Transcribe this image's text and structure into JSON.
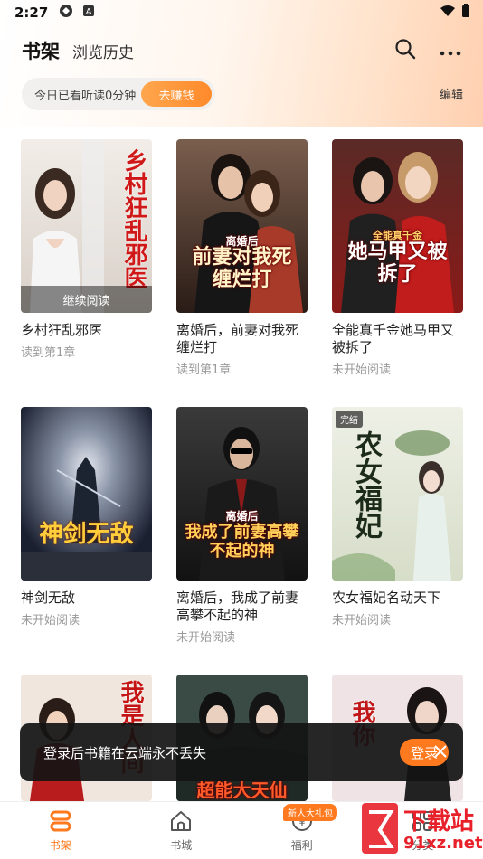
{
  "status_bar": {
    "time": "2:27"
  },
  "header": {
    "tab_shelf": "书架",
    "tab_history": "浏览历史"
  },
  "reading_pill": {
    "text": "今日已看听读0分钟",
    "earn_label": "去赚钱"
  },
  "edit_label": "编辑",
  "books": [
    {
      "title": "乡村狂乱邪医",
      "status": "读到第1章",
      "cover_text": "乡村狂乱邪医",
      "overlay": "继续阅读"
    },
    {
      "title": "离婚后，前妻对我死缠烂打",
      "status": "读到第1章",
      "cover_text": "前妻对我死缠烂打",
      "cover_sub": "离婚后"
    },
    {
      "title": "全能真千金她马甲又被拆了",
      "status": "未开始阅读",
      "cover_text": "她马甲又被拆了",
      "cover_sub": "全能真千金"
    },
    {
      "title": "神剑无敌",
      "status": "未开始阅读",
      "cover_text": "神剑无敌"
    },
    {
      "title": "离婚后，我成了前妻高攀不起的神",
      "status": "未开始阅读",
      "cover_text": "我成了前妻高攀不起的神",
      "cover_sub": "离婚后"
    },
    {
      "title": "农女福妃名动天下",
      "status": "未开始阅读",
      "cover_text": "农女福妃",
      "badge": "完结"
    },
    {
      "title": "",
      "status": "",
      "cover_text": "我是人间"
    },
    {
      "title": "",
      "status": "",
      "cover_text": "超能大天仙"
    },
    {
      "title": "",
      "status": "",
      "cover_text": "我你"
    }
  ],
  "toast": {
    "message": "登录后书籍在云端永不丢失",
    "login_label": "登录"
  },
  "bottom_nav": [
    {
      "label": "书架",
      "icon": "bookshelf-icon"
    },
    {
      "label": "书城",
      "icon": "home-icon"
    },
    {
      "label": "福利",
      "icon": "gift-coin-icon",
      "badge": "新人大礼包"
    },
    {
      "label": "分类",
      "icon": "category-grid-icon"
    }
  ],
  "watermark": {
    "text1": "下载站",
    "text2": "91xz.net"
  },
  "colors": {
    "accent": "#ff7a1f",
    "toast_bg": "#141414"
  }
}
